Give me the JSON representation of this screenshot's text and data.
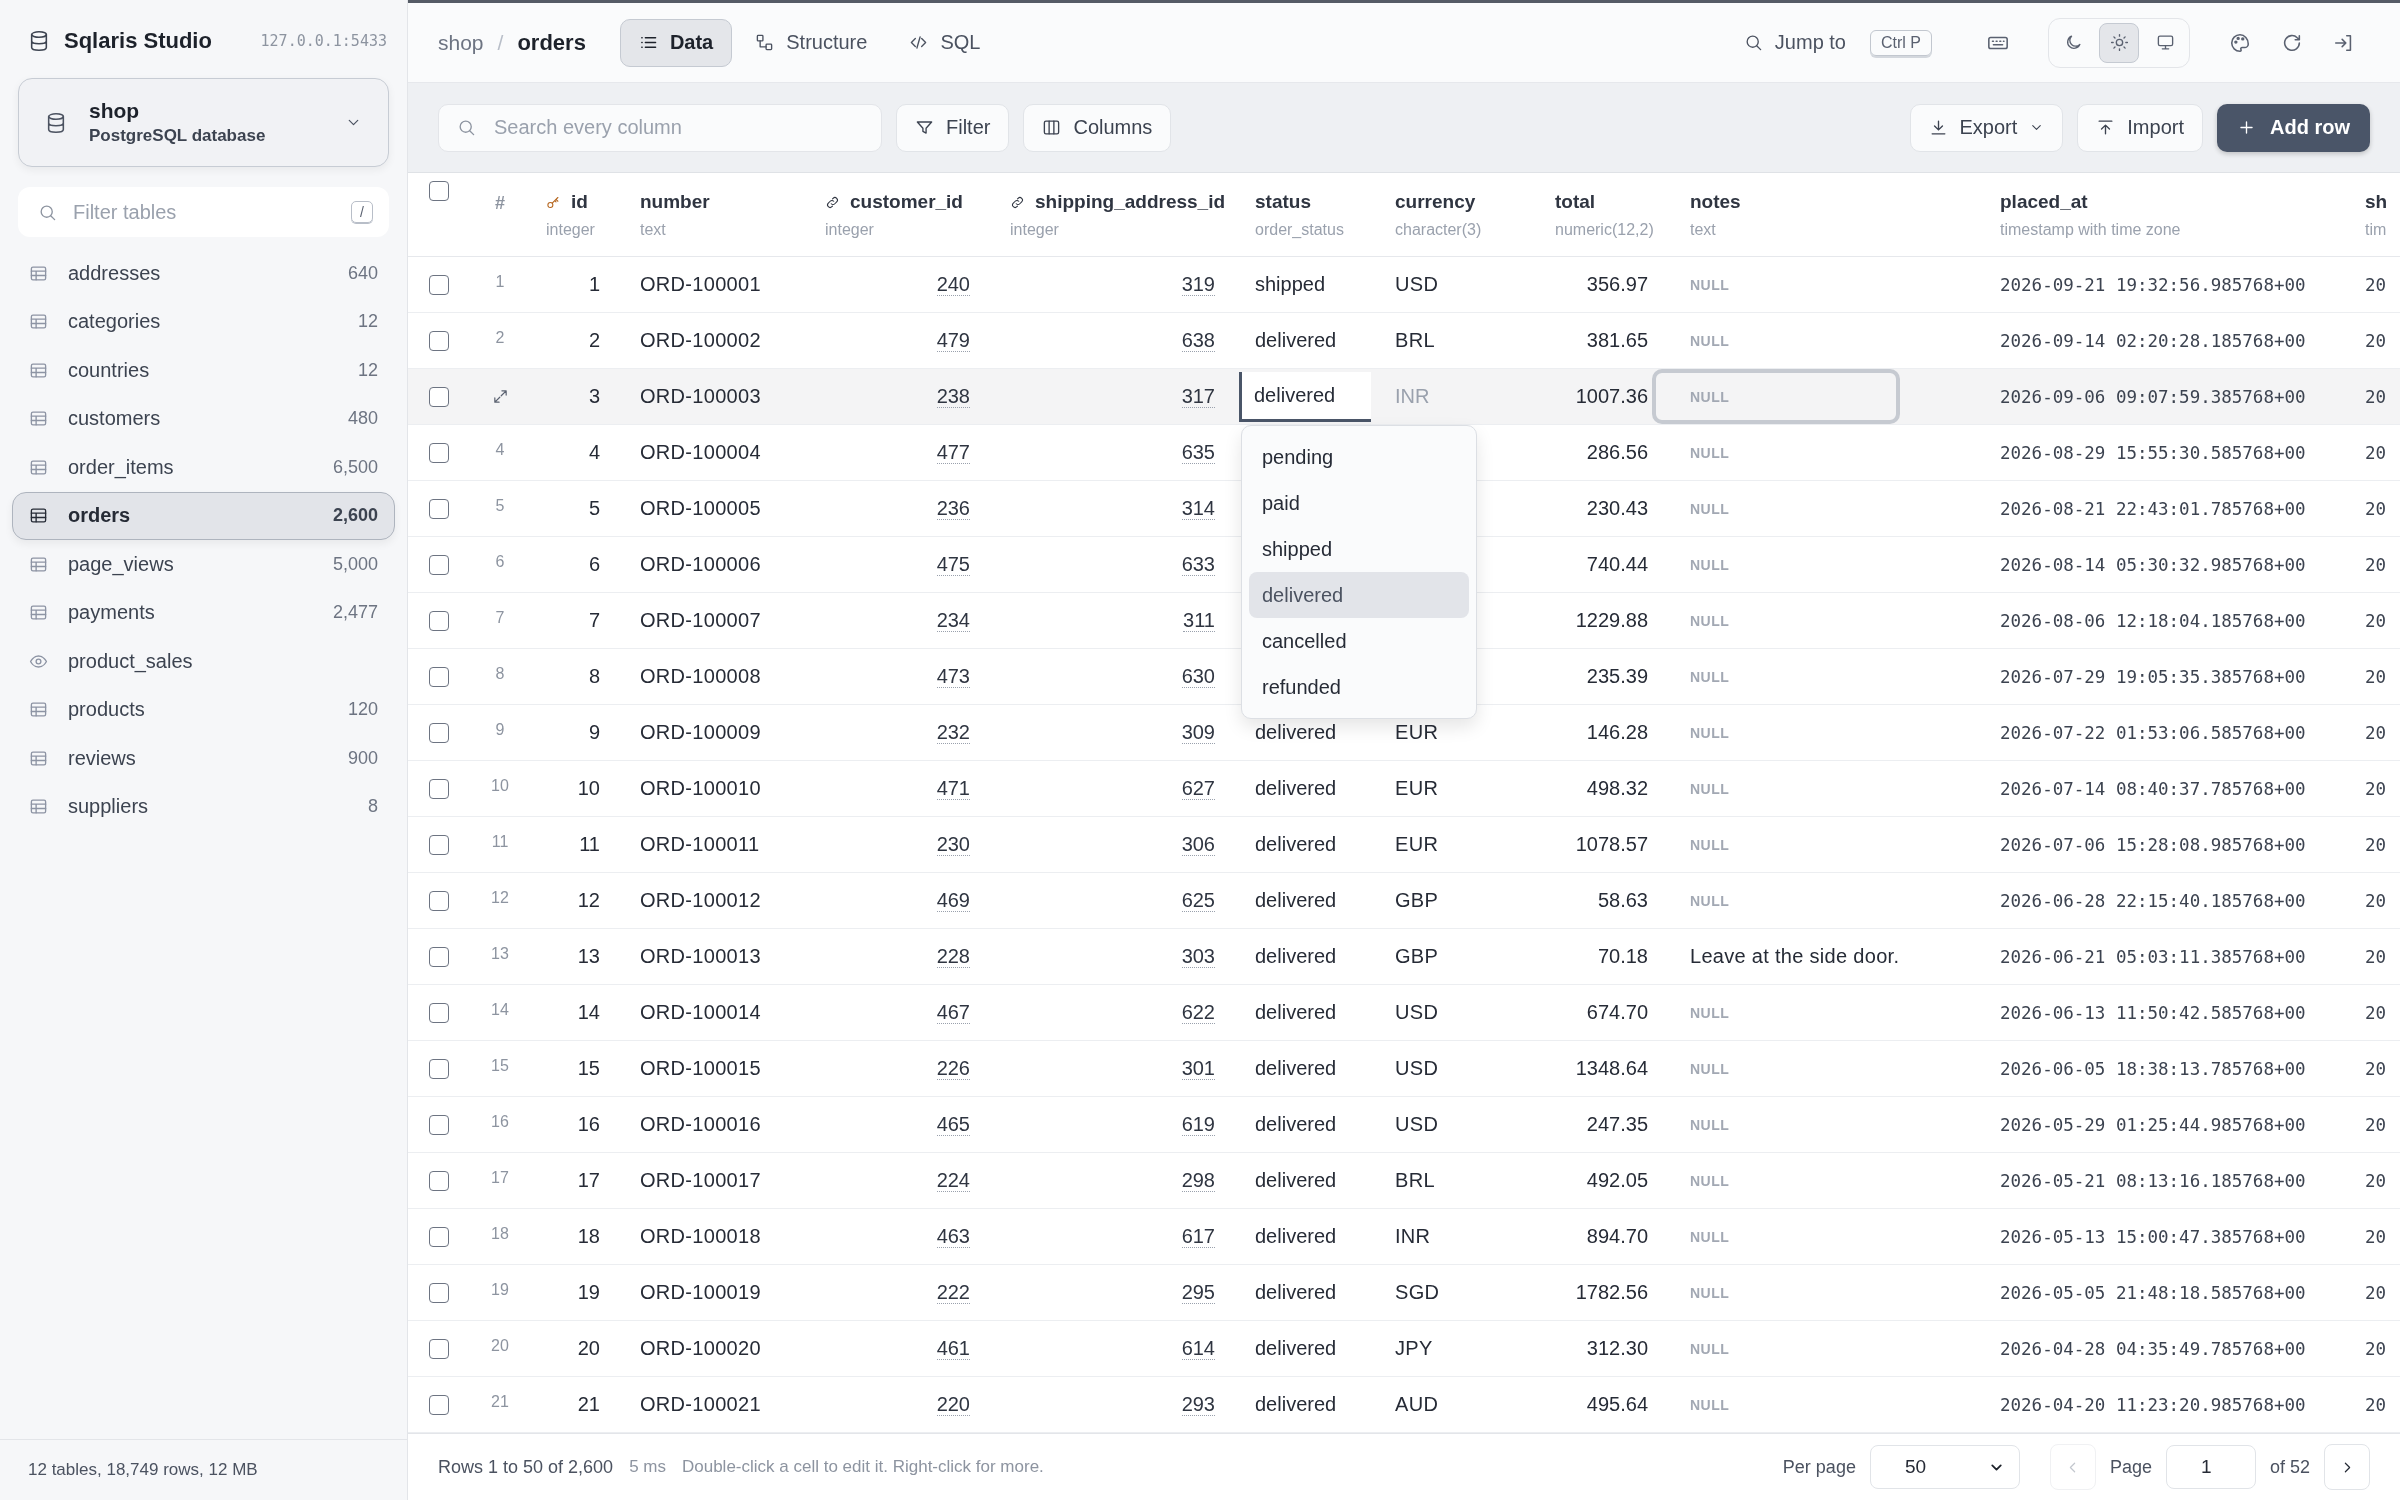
{
  "app": {
    "title": "Sqlaris Studio",
    "address": "127.0.0.1:5433"
  },
  "database": {
    "name": "shop",
    "engine": "PostgreSQL database"
  },
  "table_filter": {
    "placeholder": "Filter tables",
    "shortcut": "/"
  },
  "sidebar": {
    "items": [
      {
        "kind": "table",
        "label": "addresses",
        "count": "640",
        "selected": false
      },
      {
        "kind": "table",
        "label": "categories",
        "count": "12",
        "selected": false
      },
      {
        "kind": "table",
        "label": "countries",
        "count": "12",
        "selected": false
      },
      {
        "kind": "table",
        "label": "customers",
        "count": "480",
        "selected": false
      },
      {
        "kind": "table",
        "label": "order_items",
        "count": "6,500",
        "selected": false
      },
      {
        "kind": "table",
        "label": "orders",
        "count": "2,600",
        "selected": true
      },
      {
        "kind": "table",
        "label": "page_views",
        "count": "5,000",
        "selected": false
      },
      {
        "kind": "table",
        "label": "payments",
        "count": "2,477",
        "selected": false
      },
      {
        "kind": "view",
        "label": "product_sales",
        "selected": false
      },
      {
        "kind": "table",
        "label": "products",
        "count": "120",
        "selected": false
      },
      {
        "kind": "table",
        "label": "reviews",
        "count": "900",
        "selected": false
      },
      {
        "kind": "table",
        "label": "suppliers",
        "count": "8",
        "selected": false
      }
    ],
    "summary": "12 tables, 18,749 rows, 12 MB"
  },
  "breadcrumb": {
    "schema": "shop",
    "separator": "/",
    "table": "orders"
  },
  "tabs": [
    {
      "kind": "data",
      "label": "Data",
      "selected": true
    },
    {
      "kind": "structure",
      "label": "Structure",
      "selected": false
    },
    {
      "kind": "sql",
      "label": "SQL",
      "selected": false
    }
  ],
  "jump": {
    "label": "Jump to",
    "shortcut": "Ctrl P"
  },
  "theme": [
    {
      "kind": "dark",
      "selected": false
    },
    {
      "kind": "light",
      "selected": true
    },
    {
      "kind": "system",
      "selected": false
    }
  ],
  "toolbar": {
    "search_placeholder": "Search every column",
    "filter": "Filter",
    "columns": "Columns",
    "export": "Export",
    "import": "Import",
    "add_row": "Add row"
  },
  "table": {
    "all_selected": false,
    "row_header": "#",
    "columns": [
      {
        "name": "id",
        "type": "integer",
        "kind": "primary"
      },
      {
        "name": "number",
        "type": "text",
        "kind": "plain"
      },
      {
        "name": "customer_id",
        "type": "integer",
        "kind": "foreign"
      },
      {
        "name": "shipping_address_id",
        "type": "integer",
        "kind": "foreign"
      },
      {
        "name": "status",
        "type": "order_status",
        "kind": "enum"
      },
      {
        "name": "currency",
        "type": "character(3)",
        "kind": "plain"
      },
      {
        "name": "total",
        "type": "numeric(12,2)",
        "kind": "number"
      },
      {
        "name": "notes",
        "type": "text",
        "kind": "plain"
      },
      {
        "name": "placed_at",
        "type": "timestamp with time zone",
        "kind": "time"
      },
      {
        "name": "sh",
        "type": "tim",
        "kind": "time"
      }
    ],
    "rows": [
      {
        "row_number": "1",
        "selected": false,
        "hovered": false,
        "editing": false,
        "cells": [
          "1",
          "ORD-100001",
          "240",
          "319",
          "shipped",
          "USD",
          "356.97",
          {
            "text": "NULL",
            "null": true
          },
          "2026-09-21 19:32:56.985768+00",
          "20"
        ]
      },
      {
        "row_number": "2",
        "selected": false,
        "hovered": false,
        "editing": false,
        "cells": [
          "2",
          "ORD-100002",
          "479",
          "638",
          "delivered",
          "BRL",
          "381.65",
          {
            "text": "NULL",
            "null": true
          },
          "2026-09-14 02:20:28.185768+00",
          "20"
        ]
      },
      {
        "selected": false,
        "hovered": true,
        "editing": true,
        "cells": [
          "3",
          "ORD-100003",
          "238",
          "317",
          "delivered",
          "INR",
          "1007.36",
          {
            "text": "NULL",
            "null": true
          },
          "2026-09-06 09:07:59.385768+00",
          "20"
        ]
      },
      {
        "row_number": "4",
        "selected": false,
        "hovered": false,
        "editing": false,
        "cells": [
          "4",
          "ORD-100004",
          "477",
          "635",
          null,
          null,
          "286.56",
          {
            "text": "NULL",
            "null": true
          },
          "2026-08-29 15:55:30.585768+00",
          "20"
        ]
      },
      {
        "row_number": "5",
        "selected": false,
        "hovered": false,
        "editing": false,
        "cells": [
          "5",
          "ORD-100005",
          "236",
          "314",
          null,
          null,
          "230.43",
          {
            "text": "NULL",
            "null": true
          },
          "2026-08-21 22:43:01.785768+00",
          "20"
        ]
      },
      {
        "row_number": "6",
        "selected": false,
        "hovered": false,
        "editing": false,
        "cells": [
          "6",
          "ORD-100006",
          "475",
          "633",
          null,
          null,
          "740.44",
          {
            "text": "NULL",
            "null": true
          },
          "2026-08-14 05:30:32.985768+00",
          "20"
        ]
      },
      {
        "row_number": "7",
        "selected": false,
        "hovered": false,
        "editing": false,
        "cells": [
          "7",
          "ORD-100007",
          "234",
          "311",
          null,
          null,
          "1229.88",
          {
            "text": "NULL",
            "null": true
          },
          "2026-08-06 12:18:04.185768+00",
          "20"
        ]
      },
      {
        "row_number": "8",
        "selected": false,
        "hovered": false,
        "editing": false,
        "cells": [
          "8",
          "ORD-100008",
          "473",
          "630",
          null,
          null,
          "235.39",
          {
            "text": "NULL",
            "null": true
          },
          "2026-07-29 19:05:35.385768+00",
          "20"
        ]
      },
      {
        "row_number": "9",
        "selected": false,
        "hovered": false,
        "editing": false,
        "cells": [
          "9",
          "ORD-100009",
          "232",
          "309",
          "delivered",
          "EUR",
          "146.28",
          {
            "text": "NULL",
            "null": true
          },
          "2026-07-22 01:53:06.585768+00",
          "20"
        ]
      },
      {
        "row_number": "10",
        "selected": false,
        "hovered": false,
        "editing": false,
        "cells": [
          "10",
          "ORD-100010",
          "471",
          "627",
          "delivered",
          "EUR",
          "498.32",
          {
            "text": "NULL",
            "null": true
          },
          "2026-07-14 08:40:37.785768+00",
          "20"
        ]
      },
      {
        "row_number": "11",
        "selected": false,
        "hovered": false,
        "editing": false,
        "cells": [
          "11",
          "ORD-100011",
          "230",
          "306",
          "delivered",
          "EUR",
          "1078.57",
          {
            "text": "NULL",
            "null": true
          },
          "2026-07-06 15:28:08.985768+00",
          "20"
        ]
      },
      {
        "row_number": "12",
        "selected": false,
        "hovered": false,
        "editing": false,
        "cells": [
          "12",
          "ORD-100012",
          "469",
          "625",
          "delivered",
          "GBP",
          "58.63",
          {
            "text": "NULL",
            "null": true
          },
          "2026-06-28 22:15:40.185768+00",
          "20"
        ]
      },
      {
        "row_number": "13",
        "selected": false,
        "hovered": false,
        "editing": false,
        "cells": [
          "13",
          "ORD-100013",
          "228",
          "303",
          "delivered",
          "GBP",
          "70.18",
          "Leave at the side door.",
          "2026-06-21 05:03:11.385768+00",
          "20"
        ]
      },
      {
        "row_number": "14",
        "selected": false,
        "hovered": false,
        "editing": false,
        "cells": [
          "14",
          "ORD-100014",
          "467",
          "622",
          "delivered",
          "USD",
          "674.70",
          {
            "text": "NULL",
            "null": true
          },
          "2026-06-13 11:50:42.585768+00",
          "20"
        ]
      },
      {
        "row_number": "15",
        "selected": false,
        "hovered": false,
        "editing": false,
        "cells": [
          "15",
          "ORD-100015",
          "226",
          "301",
          "delivered",
          "USD",
          "1348.64",
          {
            "text": "NULL",
            "null": true
          },
          "2026-06-05 18:38:13.785768+00",
          "20"
        ]
      },
      {
        "row_number": "16",
        "selected": false,
        "hovered": false,
        "editing": false,
        "cells": [
          "16",
          "ORD-100016",
          "465",
          "619",
          "delivered",
          "USD",
          "247.35",
          {
            "text": "NULL",
            "null": true
          },
          "2026-05-29 01:25:44.985768+00",
          "20"
        ]
      },
      {
        "row_number": "17",
        "selected": false,
        "hovered": false,
        "editing": false,
        "cells": [
          "17",
          "ORD-100017",
          "224",
          "298",
          "delivered",
          "BRL",
          "492.05",
          {
            "text": "NULL",
            "null": true
          },
          "2026-05-21 08:13:16.185768+00",
          "20"
        ]
      },
      {
        "row_number": "18",
        "selected": false,
        "hovered": false,
        "editing": false,
        "cells": [
          "18",
          "ORD-100018",
          "463",
          "617",
          "delivered",
          "INR",
          "894.70",
          {
            "text": "NULL",
            "null": true
          },
          "2026-05-13 15:00:47.385768+00",
          "20"
        ]
      },
      {
        "row_number": "19",
        "selected": false,
        "hovered": false,
        "editing": false,
        "cells": [
          "19",
          "ORD-100019",
          "222",
          "295",
          "delivered",
          "SGD",
          "1782.56",
          {
            "text": "NULL",
            "null": true
          },
          "2026-05-05 21:48:18.585768+00",
          "20"
        ]
      },
      {
        "row_number": "20",
        "selected": false,
        "hovered": false,
        "editing": false,
        "cells": [
          "20",
          "ORD-100020",
          "461",
          "614",
          "delivered",
          "JPY",
          "312.30",
          {
            "text": "NULL",
            "null": true
          },
          "2026-04-28 04:35:49.785768+00",
          "20"
        ]
      },
      {
        "row_number": "21",
        "selected": false,
        "hovered": false,
        "editing": false,
        "cells": [
          "21",
          "ORD-100021",
          "220",
          "293",
          "delivered",
          "AUD",
          "495.64",
          {
            "text": "NULL",
            "null": true
          },
          "2026-04-20 11:23:20.985768+00",
          "20"
        ]
      }
    ]
  },
  "status_dropdown": {
    "options": [
      {
        "label": "pending",
        "selected": false
      },
      {
        "label": "paid",
        "selected": false
      },
      {
        "label": "shipped",
        "selected": false
      },
      {
        "label": "delivered",
        "selected": true
      },
      {
        "label": "cancelled",
        "selected": false
      },
      {
        "label": "refunded",
        "selected": false
      }
    ]
  },
  "footer": {
    "rows": "Rows 1 to 50 of 2,600",
    "timing": "5 ms",
    "hint": "Double-click a cell to edit it. Right-click for more.",
    "per_page_label": "Per page",
    "per_page": "50",
    "page_label": "Page",
    "page": "1",
    "page_count": "of 52",
    "prev_disabled": true,
    "next_disabled": false
  }
}
